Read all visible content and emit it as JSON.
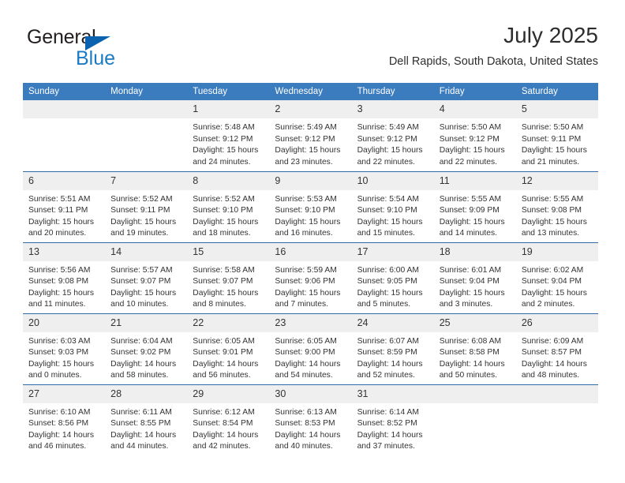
{
  "brand": {
    "name_top": "General",
    "name_bottom": "Blue",
    "triangle_color": "#0b63b0",
    "text_color": "#231f20",
    "blue_color": "#1a7bc4"
  },
  "header": {
    "title": "July 2025",
    "subtitle": "Dell Rapids, South Dakota, United States"
  },
  "theme": {
    "header_blue": "#3b7cbe",
    "row_divider_blue": "#2f6ca8",
    "daynum_band": "#efefef",
    "text": "#333333"
  },
  "weekdays": [
    "Sunday",
    "Monday",
    "Tuesday",
    "Wednesday",
    "Thursday",
    "Friday",
    "Saturday"
  ],
  "labels": {
    "sunrise_prefix": "Sunrise: ",
    "sunset_prefix": "Sunset: ",
    "daylight_prefix": "Daylight: "
  },
  "weeks": [
    [
      {
        "day": "",
        "sunrise": "",
        "sunset": "",
        "daylight": ""
      },
      {
        "day": "",
        "sunrise": "",
        "sunset": "",
        "daylight": ""
      },
      {
        "day": "1",
        "sunrise": "Sunrise: 5:48 AM",
        "sunset": "Sunset: 9:12 PM",
        "daylight": "Daylight: 15 hours and 24 minutes."
      },
      {
        "day": "2",
        "sunrise": "Sunrise: 5:49 AM",
        "sunset": "Sunset: 9:12 PM",
        "daylight": "Daylight: 15 hours and 23 minutes."
      },
      {
        "day": "3",
        "sunrise": "Sunrise: 5:49 AM",
        "sunset": "Sunset: 9:12 PM",
        "daylight": "Daylight: 15 hours and 22 minutes."
      },
      {
        "day": "4",
        "sunrise": "Sunrise: 5:50 AM",
        "sunset": "Sunset: 9:12 PM",
        "daylight": "Daylight: 15 hours and 22 minutes."
      },
      {
        "day": "5",
        "sunrise": "Sunrise: 5:50 AM",
        "sunset": "Sunset: 9:11 PM",
        "daylight": "Daylight: 15 hours and 21 minutes."
      }
    ],
    [
      {
        "day": "6",
        "sunrise": "Sunrise: 5:51 AM",
        "sunset": "Sunset: 9:11 PM",
        "daylight": "Daylight: 15 hours and 20 minutes."
      },
      {
        "day": "7",
        "sunrise": "Sunrise: 5:52 AM",
        "sunset": "Sunset: 9:11 PM",
        "daylight": "Daylight: 15 hours and 19 minutes."
      },
      {
        "day": "8",
        "sunrise": "Sunrise: 5:52 AM",
        "sunset": "Sunset: 9:10 PM",
        "daylight": "Daylight: 15 hours and 18 minutes."
      },
      {
        "day": "9",
        "sunrise": "Sunrise: 5:53 AM",
        "sunset": "Sunset: 9:10 PM",
        "daylight": "Daylight: 15 hours and 16 minutes."
      },
      {
        "day": "10",
        "sunrise": "Sunrise: 5:54 AM",
        "sunset": "Sunset: 9:10 PM",
        "daylight": "Daylight: 15 hours and 15 minutes."
      },
      {
        "day": "11",
        "sunrise": "Sunrise: 5:55 AM",
        "sunset": "Sunset: 9:09 PM",
        "daylight": "Daylight: 15 hours and 14 minutes."
      },
      {
        "day": "12",
        "sunrise": "Sunrise: 5:55 AM",
        "sunset": "Sunset: 9:08 PM",
        "daylight": "Daylight: 15 hours and 13 minutes."
      }
    ],
    [
      {
        "day": "13",
        "sunrise": "Sunrise: 5:56 AM",
        "sunset": "Sunset: 9:08 PM",
        "daylight": "Daylight: 15 hours and 11 minutes."
      },
      {
        "day": "14",
        "sunrise": "Sunrise: 5:57 AM",
        "sunset": "Sunset: 9:07 PM",
        "daylight": "Daylight: 15 hours and 10 minutes."
      },
      {
        "day": "15",
        "sunrise": "Sunrise: 5:58 AM",
        "sunset": "Sunset: 9:07 PM",
        "daylight": "Daylight: 15 hours and 8 minutes."
      },
      {
        "day": "16",
        "sunrise": "Sunrise: 5:59 AM",
        "sunset": "Sunset: 9:06 PM",
        "daylight": "Daylight: 15 hours and 7 minutes."
      },
      {
        "day": "17",
        "sunrise": "Sunrise: 6:00 AM",
        "sunset": "Sunset: 9:05 PM",
        "daylight": "Daylight: 15 hours and 5 minutes."
      },
      {
        "day": "18",
        "sunrise": "Sunrise: 6:01 AM",
        "sunset": "Sunset: 9:04 PM",
        "daylight": "Daylight: 15 hours and 3 minutes."
      },
      {
        "day": "19",
        "sunrise": "Sunrise: 6:02 AM",
        "sunset": "Sunset: 9:04 PM",
        "daylight": "Daylight: 15 hours and 2 minutes."
      }
    ],
    [
      {
        "day": "20",
        "sunrise": "Sunrise: 6:03 AM",
        "sunset": "Sunset: 9:03 PM",
        "daylight": "Daylight: 15 hours and 0 minutes."
      },
      {
        "day": "21",
        "sunrise": "Sunrise: 6:04 AM",
        "sunset": "Sunset: 9:02 PM",
        "daylight": "Daylight: 14 hours and 58 minutes."
      },
      {
        "day": "22",
        "sunrise": "Sunrise: 6:05 AM",
        "sunset": "Sunset: 9:01 PM",
        "daylight": "Daylight: 14 hours and 56 minutes."
      },
      {
        "day": "23",
        "sunrise": "Sunrise: 6:05 AM",
        "sunset": "Sunset: 9:00 PM",
        "daylight": "Daylight: 14 hours and 54 minutes."
      },
      {
        "day": "24",
        "sunrise": "Sunrise: 6:07 AM",
        "sunset": "Sunset: 8:59 PM",
        "daylight": "Daylight: 14 hours and 52 minutes."
      },
      {
        "day": "25",
        "sunrise": "Sunrise: 6:08 AM",
        "sunset": "Sunset: 8:58 PM",
        "daylight": "Daylight: 14 hours and 50 minutes."
      },
      {
        "day": "26",
        "sunrise": "Sunrise: 6:09 AM",
        "sunset": "Sunset: 8:57 PM",
        "daylight": "Daylight: 14 hours and 48 minutes."
      }
    ],
    [
      {
        "day": "27",
        "sunrise": "Sunrise: 6:10 AM",
        "sunset": "Sunset: 8:56 PM",
        "daylight": "Daylight: 14 hours and 46 minutes."
      },
      {
        "day": "28",
        "sunrise": "Sunrise: 6:11 AM",
        "sunset": "Sunset: 8:55 PM",
        "daylight": "Daylight: 14 hours and 44 minutes."
      },
      {
        "day": "29",
        "sunrise": "Sunrise: 6:12 AM",
        "sunset": "Sunset: 8:54 PM",
        "daylight": "Daylight: 14 hours and 42 minutes."
      },
      {
        "day": "30",
        "sunrise": "Sunrise: 6:13 AM",
        "sunset": "Sunset: 8:53 PM",
        "daylight": "Daylight: 14 hours and 40 minutes."
      },
      {
        "day": "31",
        "sunrise": "Sunrise: 6:14 AM",
        "sunset": "Sunset: 8:52 PM",
        "daylight": "Daylight: 14 hours and 37 minutes."
      },
      {
        "day": "",
        "sunrise": "",
        "sunset": "",
        "daylight": ""
      },
      {
        "day": "",
        "sunrise": "",
        "sunset": "",
        "daylight": ""
      }
    ]
  ]
}
